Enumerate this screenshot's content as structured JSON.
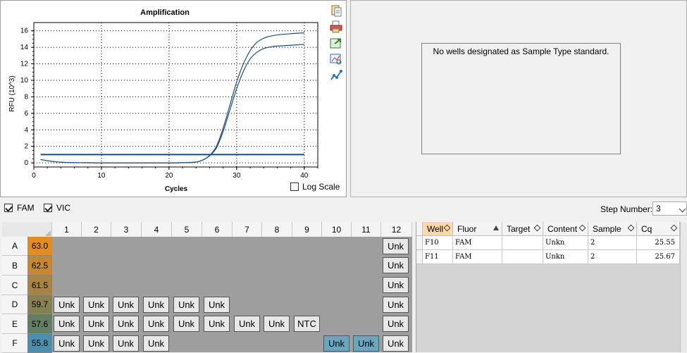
{
  "chart": {
    "title": "Amplification",
    "ylabel": "RFU (10^3)",
    "xlabel": "Cycles",
    "log_scale_label": "Log Scale",
    "log_scale_checked": false
  },
  "chart_data": {
    "type": "line",
    "title": "Amplification",
    "xlabel": "Cycles",
    "ylabel": "RFU (10^3)",
    "xlim": [
      0,
      42
    ],
    "ylim": [
      -0.5,
      17
    ],
    "x_ticks": [
      0,
      10,
      20,
      30,
      40
    ],
    "y_ticks": [
      0,
      2,
      4,
      6,
      8,
      10,
      12,
      14,
      16
    ],
    "grid": true,
    "threshold": 1.0,
    "series": [
      {
        "x": [
          1,
          3,
          5,
          10,
          15,
          20,
          22,
          24,
          25,
          26,
          27,
          28,
          29,
          30,
          31,
          32,
          33,
          34,
          35,
          36,
          38,
          40
        ],
        "values": [
          0.4,
          0.15,
          0.05,
          0,
          0,
          0,
          0.02,
          0.1,
          0.35,
          0.9,
          2.0,
          4.2,
          7.0,
          9.8,
          12.0,
          13.6,
          14.6,
          15.1,
          15.35,
          15.5,
          15.65,
          15.75
        ]
      },
      {
        "x": [
          1,
          3,
          5,
          10,
          15,
          20,
          22,
          24,
          25,
          26,
          27,
          28,
          29,
          30,
          31,
          32,
          33,
          34,
          35,
          36,
          38,
          40
        ],
        "values": [
          0.4,
          0.15,
          0.05,
          0,
          0,
          0,
          0.02,
          0.1,
          0.35,
          0.85,
          1.8,
          3.8,
          6.4,
          9.0,
          11.1,
          12.6,
          13.4,
          13.85,
          14.05,
          14.15,
          14.25,
          14.35
        ]
      }
    ]
  },
  "standard": {
    "message": "No wells designated as Sample Type standard."
  },
  "fluorophores": [
    {
      "label": "FAM",
      "checked": true
    },
    {
      "label": "VIC",
      "checked": true
    }
  ],
  "step": {
    "label": "Step Number:",
    "value": "3"
  },
  "plate": {
    "columns": [
      "1",
      "2",
      "3",
      "4",
      "5",
      "6",
      "7",
      "8",
      "9",
      "10",
      "11",
      "12"
    ],
    "rows": [
      {
        "label": "A",
        "temp": "63.0",
        "temp_color": "#e58c1f",
        "wells": [
          "",
          "",
          "",
          "",
          "",
          "",
          "",
          "",
          "",
          "",
          "",
          "Unk"
        ]
      },
      {
        "label": "B",
        "temp": "62.5",
        "temp_color": "#c7872e",
        "wells": [
          "",
          "",
          "",
          "",
          "",
          "",
          "",
          "",
          "",
          "",
          "",
          "Unk"
        ]
      },
      {
        "label": "C",
        "temp": "61.5",
        "temp_color": "#a8843f",
        "wells": [
          "",
          "",
          "",
          "",
          "",
          "",
          "",
          "",
          "",
          "",
          "",
          "Unk"
        ]
      },
      {
        "label": "D",
        "temp": "59.7",
        "temp_color": "#858151",
        "wells": [
          "Unk",
          "Unk",
          "Unk",
          "Unk",
          "Unk",
          "Unk",
          "",
          "",
          "",
          "",
          "",
          "Unk"
        ]
      },
      {
        "label": "E",
        "temp": "57.6",
        "temp_color": "#627e63",
        "wells": [
          "Unk",
          "Unk",
          "Unk",
          "Unk",
          "Unk",
          "Unk",
          "Unk",
          "Unk",
          "NTC",
          "",
          "",
          "Unk"
        ]
      },
      {
        "label": "F",
        "temp": "55.8",
        "temp_color": "#4b8fae",
        "wells": [
          "Unk",
          "Unk",
          "Unk",
          "Unk",
          "",
          "",
          "",
          "",
          "",
          "Unk",
          "Unk",
          "Unk"
        ]
      }
    ],
    "selected": [
      [
        5,
        9
      ],
      [
        5,
        10
      ]
    ]
  },
  "results": {
    "columns": [
      "Well",
      "Fluor",
      "Target",
      "Content",
      "Sample",
      "Cq"
    ],
    "rows": [
      [
        "F10",
        "FAM",
        "",
        "Unkn",
        "2",
        "25.55"
      ],
      [
        "F11",
        "FAM",
        "",
        "Unkn",
        "2",
        "25.67"
      ]
    ]
  },
  "colors": {
    "curve": "#1f4e79",
    "threshold": "#0f4f86",
    "selected_well": "#6aa7bd"
  }
}
